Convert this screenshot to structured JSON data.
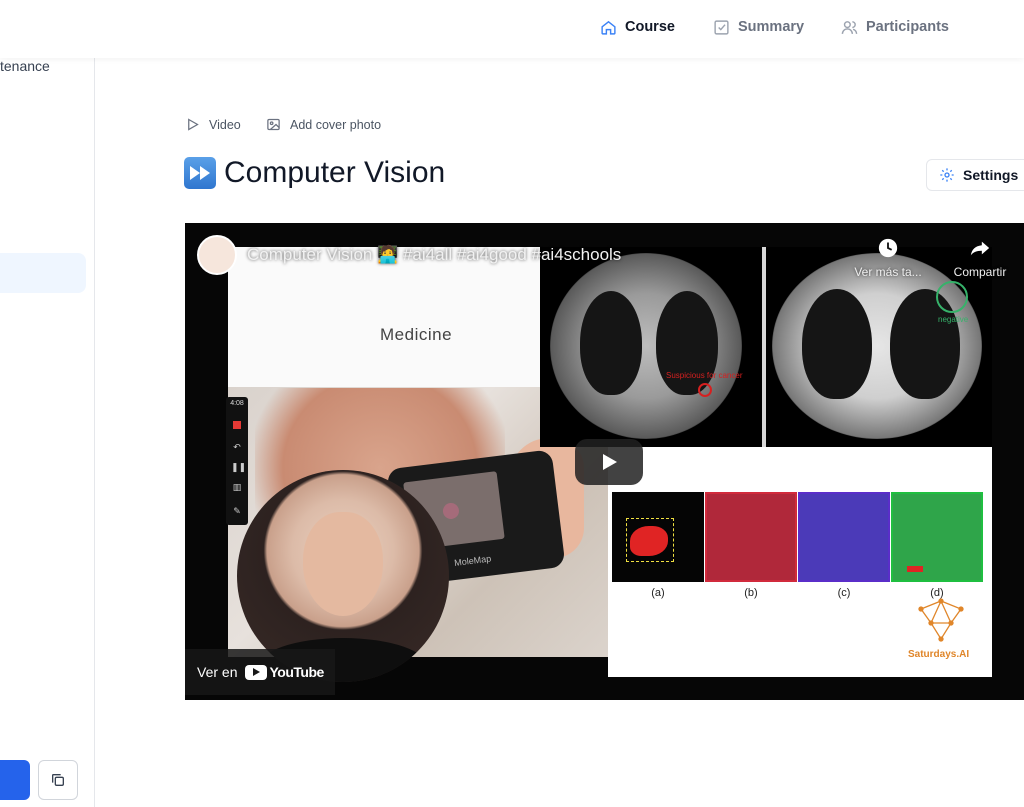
{
  "topnav": {
    "course": "Course",
    "summary": "Summary",
    "participants": "Participants"
  },
  "sidebar": {
    "partial_item": "tenance"
  },
  "lesson": {
    "video_chip": "Video",
    "cover_chip": "Add cover photo",
    "title": "Computer Vision",
    "title_emoji": "fast-forward-icon",
    "settings_label": "Settings"
  },
  "video": {
    "title": "Computer Vision 🧑‍💻 #ai4all #ai4good #ai4schools",
    "watch_later": "Ver más ta...",
    "share": "Compartir",
    "watch_on": "Ver en",
    "youtube": "YouTube",
    "slide": {
      "medicine": "Medicine",
      "suspicious": "Suspicious for cancer",
      "negative": "negative",
      "device_brand": "MoleMap",
      "rec_time": "4:08",
      "panel_a": "(a)",
      "panel_b": "(b)",
      "panel_c": "(c)",
      "panel_d": "(d)",
      "brand": "Saturdays.AI"
    }
  },
  "colors": {
    "accent": "#2563eb",
    "active_bg": "#eff6ff"
  }
}
